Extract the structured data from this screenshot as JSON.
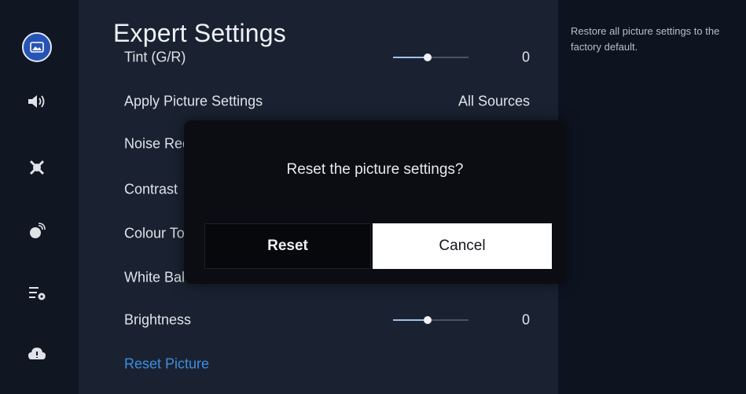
{
  "sidebar": {
    "items": [
      {
        "icon": "picture-icon",
        "active": true
      },
      {
        "icon": "sound-icon",
        "active": false
      },
      {
        "icon": "broadcasting-icon",
        "active": false
      },
      {
        "icon": "network-icon",
        "active": false
      },
      {
        "icon": "general-icon",
        "active": false
      },
      {
        "icon": "support-icon",
        "active": false
      }
    ]
  },
  "panel": {
    "title": "Expert Settings",
    "rows": [
      {
        "label": "Tint (G/R)",
        "value": "0",
        "slider": 0.45
      },
      {
        "label": "Apply Picture Settings",
        "value": "All Sources"
      },
      {
        "label": "Noise Reduction",
        "value": ""
      },
      {
        "label": "Contrast",
        "value": ""
      },
      {
        "label": "Colour Tone",
        "value": ""
      },
      {
        "label": "White Balance",
        "value": ""
      },
      {
        "label": "Brightness",
        "value": "0",
        "slider": 0.45
      },
      {
        "label": "Reset Picture",
        "value": ""
      }
    ]
  },
  "description": "Restore all picture settings to the factory default.",
  "dialog": {
    "message": "Reset the picture settings?",
    "reset_label": "Reset",
    "cancel_label": "Cancel"
  },
  "colors": {
    "accent": "#2753b4",
    "link": "#3d8ee0",
    "panel": "#1a2231",
    "dialog": "#0b0d12"
  }
}
